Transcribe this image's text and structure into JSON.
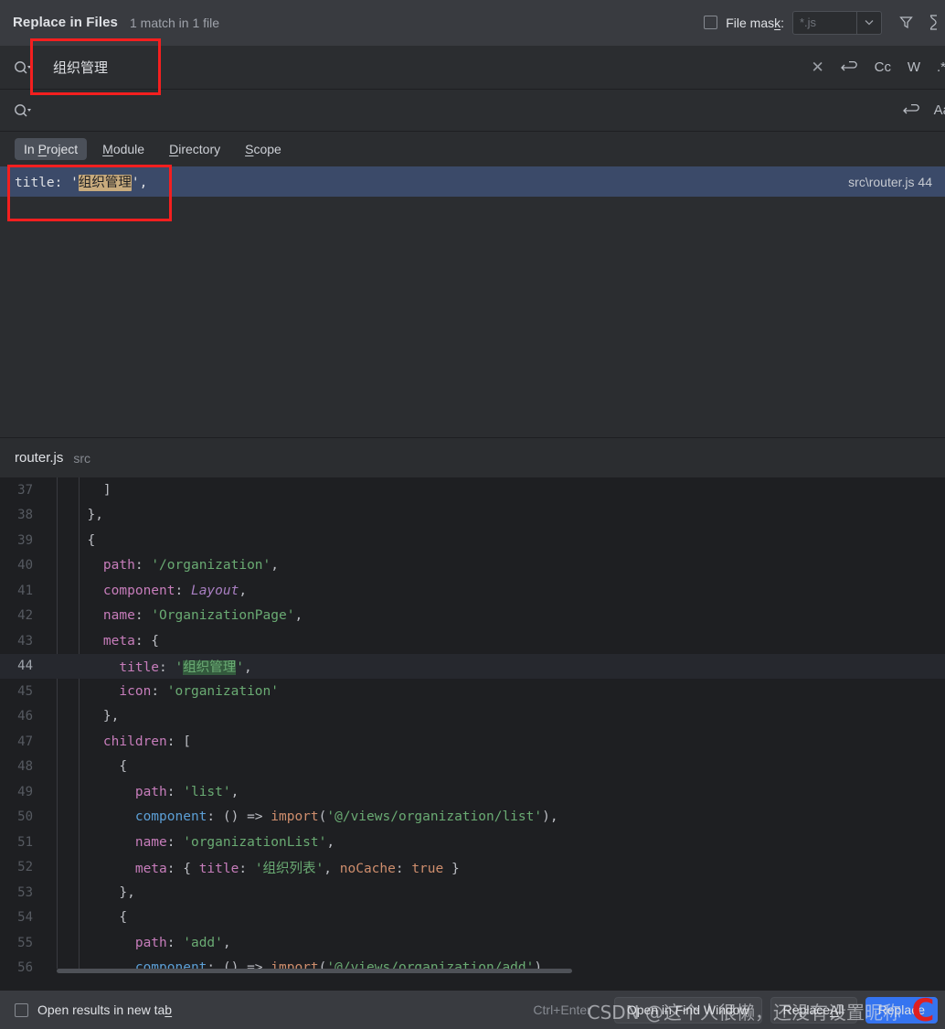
{
  "header": {
    "title": "Replace in Files",
    "match_summary": "1 match in 1 file",
    "file_mask_label_pre": "File mas",
    "file_mask_label_mnemonic": "k",
    "file_mask_label_post": ":",
    "file_mask_placeholder": "*.js",
    "file_mask_checked": false,
    "filter_icon": "filter-icon",
    "pin_icon": "pin-icon"
  },
  "search": {
    "value": "组织管理",
    "icon": "search-dropdown-icon",
    "options": [
      {
        "name": "clear-search",
        "glyph": "✕"
      },
      {
        "name": "search-history",
        "glyph": "⮐"
      },
      {
        "name": "match-case",
        "glyph": "Cc"
      },
      {
        "name": "words",
        "glyph": "W"
      },
      {
        "name": "regex",
        "glyph": ".*"
      }
    ]
  },
  "replace": {
    "value": "",
    "placeholder": "",
    "icon": "search-dropdown-icon",
    "options": [
      {
        "name": "replace-history",
        "glyph": "⮐"
      },
      {
        "name": "preserve-case",
        "glyph": "Aa"
      }
    ]
  },
  "tabs": [
    {
      "label_pre": "In ",
      "mnemonic": "P",
      "label_post": "roject",
      "active": true,
      "name": "tab-in-project"
    },
    {
      "label_pre": "",
      "mnemonic": "M",
      "label_post": "odule",
      "active": false,
      "name": "tab-module"
    },
    {
      "label_pre": "",
      "mnemonic": "D",
      "label_post": "irectory",
      "active": false,
      "name": "tab-directory"
    },
    {
      "label_pre": "",
      "mnemonic": "S",
      "label_post": "cope",
      "active": false,
      "name": "tab-scope"
    }
  ],
  "result": {
    "prefix": "title: '",
    "match": "组织管理",
    "suffix": "',",
    "path": "src\\router.js 44"
  },
  "preview": {
    "file_name": "router.js",
    "directory": "src",
    "first_line_number": 37,
    "current_line": 44,
    "lines": [
      {
        "n": 37,
        "tokens": [
          {
            "t": "    ]",
            "c": "pn"
          }
        ]
      },
      {
        "n": 38,
        "tokens": [
          {
            "t": "  },",
            "c": "pn"
          }
        ]
      },
      {
        "n": 39,
        "tokens": [
          {
            "t": "  {",
            "c": "pn"
          }
        ]
      },
      {
        "n": 40,
        "tokens": [
          {
            "t": "    ",
            "c": "pn"
          },
          {
            "t": "path",
            "c": "pk"
          },
          {
            "t": ": ",
            "c": "pn"
          },
          {
            "t": "'/organization'",
            "c": "st"
          },
          {
            "t": ",",
            "c": "pn"
          }
        ]
      },
      {
        "n": 41,
        "tokens": [
          {
            "t": "    ",
            "c": "pn"
          },
          {
            "t": "component",
            "c": "pk"
          },
          {
            "t": ": ",
            "c": "pn"
          },
          {
            "t": "Layout",
            "c": "it"
          },
          {
            "t": ",",
            "c": "pn"
          }
        ]
      },
      {
        "n": 42,
        "tokens": [
          {
            "t": "    ",
            "c": "pn"
          },
          {
            "t": "name",
            "c": "pk"
          },
          {
            "t": ": ",
            "c": "pn"
          },
          {
            "t": "'OrganizationPage'",
            "c": "st"
          },
          {
            "t": ",",
            "c": "pn"
          }
        ]
      },
      {
        "n": 43,
        "tokens": [
          {
            "t": "    ",
            "c": "pn"
          },
          {
            "t": "meta",
            "c": "pk"
          },
          {
            "t": ": {",
            "c": "pn"
          }
        ]
      },
      {
        "n": 44,
        "tokens": [
          {
            "t": "      ",
            "c": "pn"
          },
          {
            "t": "title",
            "c": "pk"
          },
          {
            "t": ": ",
            "c": "pn"
          },
          {
            "t": "'",
            "c": "st"
          },
          {
            "t": "组织管理",
            "c": "st match"
          },
          {
            "t": "'",
            "c": "st"
          },
          {
            "t": ",",
            "c": "pn"
          }
        ]
      },
      {
        "n": 45,
        "tokens": [
          {
            "t": "      ",
            "c": "pn"
          },
          {
            "t": "icon",
            "c": "pk"
          },
          {
            "t": ": ",
            "c": "pn"
          },
          {
            "t": "'organization'",
            "c": "st"
          }
        ]
      },
      {
        "n": 46,
        "tokens": [
          {
            "t": "    },",
            "c": "pn"
          }
        ]
      },
      {
        "n": 47,
        "tokens": [
          {
            "t": "    ",
            "c": "pn"
          },
          {
            "t": "children",
            "c": "pk"
          },
          {
            "t": ": [",
            "c": "pn"
          }
        ]
      },
      {
        "n": 48,
        "tokens": [
          {
            "t": "      {",
            "c": "pn"
          }
        ]
      },
      {
        "n": 49,
        "tokens": [
          {
            "t": "        ",
            "c": "pn"
          },
          {
            "t": "path",
            "c": "pk"
          },
          {
            "t": ": ",
            "c": "pn"
          },
          {
            "t": "'list'",
            "c": "st"
          },
          {
            "t": ",",
            "c": "pn"
          }
        ]
      },
      {
        "n": 50,
        "tokens": [
          {
            "t": "        ",
            "c": "pn"
          },
          {
            "t": "component",
            "c": "bl"
          },
          {
            "t": ": () => ",
            "c": "pn"
          },
          {
            "t": "import",
            "c": "or"
          },
          {
            "t": "(",
            "c": "pn"
          },
          {
            "t": "'@/views/organization/list'",
            "c": "st"
          },
          {
            "t": "),",
            "c": "pn"
          }
        ]
      },
      {
        "n": 51,
        "tokens": [
          {
            "t": "        ",
            "c": "pn"
          },
          {
            "t": "name",
            "c": "pk"
          },
          {
            "t": ": ",
            "c": "pn"
          },
          {
            "t": "'organizationList'",
            "c": "st"
          },
          {
            "t": ",",
            "c": "pn"
          }
        ]
      },
      {
        "n": 52,
        "tokens": [
          {
            "t": "        ",
            "c": "pn"
          },
          {
            "t": "meta",
            "c": "pk"
          },
          {
            "t": ": { ",
            "c": "pn"
          },
          {
            "t": "title",
            "c": "pk"
          },
          {
            "t": ": ",
            "c": "pn"
          },
          {
            "t": "'组织列表'",
            "c": "st"
          },
          {
            "t": ", ",
            "c": "pn"
          },
          {
            "t": "noCache",
            "c": "or"
          },
          {
            "t": ": ",
            "c": "pn"
          },
          {
            "t": "true",
            "c": "or"
          },
          {
            "t": " }",
            "c": "pn"
          }
        ]
      },
      {
        "n": 53,
        "tokens": [
          {
            "t": "      },",
            "c": "pn"
          }
        ]
      },
      {
        "n": 54,
        "tokens": [
          {
            "t": "      {",
            "c": "pn"
          }
        ]
      },
      {
        "n": 55,
        "tokens": [
          {
            "t": "        ",
            "c": "pn"
          },
          {
            "t": "path",
            "c": "pk"
          },
          {
            "t": ": ",
            "c": "pn"
          },
          {
            "t": "'add'",
            "c": "st"
          },
          {
            "t": ",",
            "c": "pn"
          }
        ]
      },
      {
        "n": 56,
        "tokens": [
          {
            "t": "        ",
            "c": "pn"
          },
          {
            "t": "component",
            "c": "bl"
          },
          {
            "t": ": () => ",
            "c": "pn"
          },
          {
            "t": "import",
            "c": "or"
          },
          {
            "t": "(",
            "c": "pn"
          },
          {
            "t": "'@/views/organization/add'",
            "c": "st"
          },
          {
            "t": "),",
            "c": "pn"
          }
        ]
      }
    ]
  },
  "footer": {
    "new_tab_label_pre": "Open results in new ta",
    "new_tab_mnemonic": "b",
    "new_tab_checked": false,
    "shortcut_hint": "Ctrl+Enter",
    "open_find_window": "Open in Find Window",
    "replace_all_pre": "Replace ",
    "replace_all_mnemonic": "A",
    "replace_all_post": "ll",
    "replace_label": "Replace"
  },
  "watermark": {
    "text": "CSDN @这个人很懒，还没有设置昵称",
    "logo": "C"
  },
  "colors": {
    "accent": "#3574f0",
    "annotation": "#f41f1f",
    "selection": "#3b4a69",
    "match_highlight": "#c8ab7d",
    "code_match": "#33593d"
  }
}
